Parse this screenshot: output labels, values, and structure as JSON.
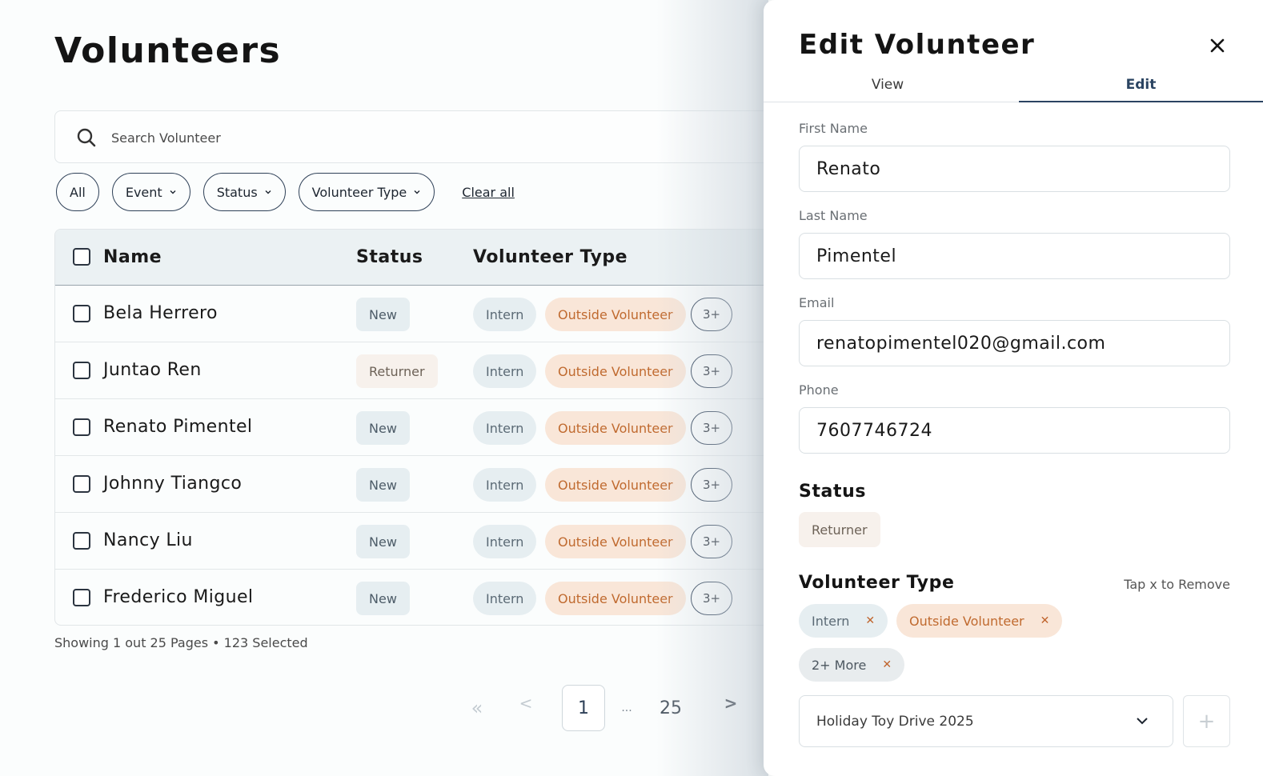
{
  "page": {
    "title": "Volunteers",
    "search_placeholder": "Search Volunteer",
    "filters": [
      {
        "label": "All",
        "dropdown": false
      },
      {
        "label": "Event",
        "dropdown": true
      },
      {
        "label": "Status",
        "dropdown": true
      },
      {
        "label": "Volunteer Type",
        "dropdown": true
      }
    ],
    "clear_all": "Clear all"
  },
  "table": {
    "headers": {
      "name": "Name",
      "status": "Status",
      "type": "Volunteer Type"
    },
    "rows": [
      {
        "name": "Bela Herrero",
        "status": "New",
        "status_kind": "new",
        "type1": "Intern",
        "type2": "Outside Volunteer",
        "more": "3+"
      },
      {
        "name": "Juntao Ren",
        "status": "Returner",
        "status_kind": "returner",
        "type1": "Intern",
        "type2": "Outside Volunteer",
        "more": "3+"
      },
      {
        "name": "Renato Pimentel",
        "status": "New",
        "status_kind": "new",
        "type1": "Intern",
        "type2": "Outside Volunteer",
        "more": "3+"
      },
      {
        "name": "Johnny Tiangco",
        "status": "New",
        "status_kind": "new",
        "type1": "Intern",
        "type2": "Outside Volunteer",
        "more": "3+"
      },
      {
        "name": "Nancy Liu",
        "status": "New",
        "status_kind": "new",
        "type1": "Intern",
        "type2": "Outside Volunteer",
        "more": "3+"
      },
      {
        "name": "Frederico Miguel",
        "status": "New",
        "status_kind": "new",
        "type1": "Intern",
        "type2": "Outside Volunteer",
        "more": "3+"
      }
    ],
    "summary": "Showing 1 out 25 Pages • 123 Selected"
  },
  "pagination": {
    "first": "«",
    "prev": "<",
    "current": "1",
    "ellipsis": "...",
    "last": "25",
    "next": ">"
  },
  "drawer": {
    "title": "Edit Volunteer",
    "tabs": [
      {
        "label": "View",
        "active": false
      },
      {
        "label": "Edit",
        "active": true
      }
    ],
    "fields": {
      "first_name": {
        "label": "First Name",
        "value": "Renato"
      },
      "last_name": {
        "label": "Last Name",
        "value": "Pimentel"
      },
      "email": {
        "label": "Email",
        "value": "renatopimentel020@gmail.com"
      },
      "phone": {
        "label": "Phone",
        "value": "7607746724"
      }
    },
    "status": {
      "title": "Status",
      "value": "Returner"
    },
    "volunteer_type": {
      "title": "Volunteer Type",
      "hint": "Tap x to Remove",
      "tags": [
        "Intern",
        "Outside Volunteer",
        "2+ More"
      ],
      "remove_glyph": "✕"
    },
    "event_select": {
      "value": "Holiday Toy Drive 2025"
    },
    "add_button": "+"
  },
  "colors": {
    "accent": "#2b4462",
    "outside_volunteer_bg": "#f9e6d8",
    "outside_volunteer_text": "#c06a2f",
    "neutral_pill_bg": "#e6eef1",
    "returner_bg": "#f7f1ec"
  },
  "icons": [
    "search-icon",
    "chevron-down-icon",
    "close-icon",
    "remove-x-icon"
  ]
}
